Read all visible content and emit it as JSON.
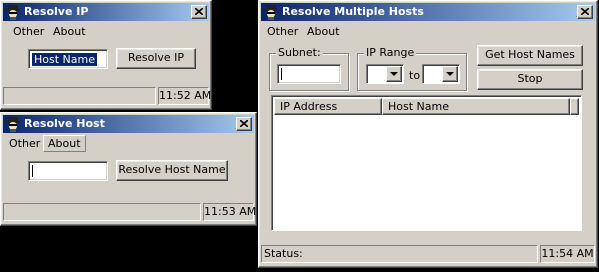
{
  "colors": {
    "desktop": "#000000",
    "window_face": "#d4d0c8",
    "title_active_start": "#0a246a",
    "title_active_end": "#a6caf0",
    "selection": "#0a246a"
  },
  "window_resolve_ip": {
    "title": "Resolve IP",
    "icon": "spy-icon",
    "menu": [
      {
        "label": "Other"
      },
      {
        "label": "About"
      }
    ],
    "hostname_input": {
      "value": "Host Name"
    },
    "resolve_button": "Resolve IP",
    "status": {
      "message": "",
      "clock": "11:52 AM"
    }
  },
  "window_resolve_host": {
    "title": "Resolve Host",
    "icon": "spy-icon",
    "menu": [
      {
        "label": "Other"
      },
      {
        "label": "About"
      }
    ],
    "ip_input": {
      "value": ""
    },
    "resolve_button": "Resolve Host Name",
    "status": {
      "message": "",
      "clock": "11:53 AM"
    }
  },
  "window_resolve_multiple": {
    "title": "Resolve Multiple Hosts",
    "icon": "spy-icon",
    "menu": [
      {
        "label": "Other"
      },
      {
        "label": "About"
      }
    ],
    "subnet_group": {
      "label": "Subnet:",
      "value": ""
    },
    "range_group": {
      "label": "IP Range",
      "from_value": "",
      "to_label": "to",
      "to_value": ""
    },
    "get_names_button": "Get Host Names",
    "stop_button": "Stop",
    "list": {
      "columns": [
        "IP Address",
        "Host Name"
      ],
      "rows": []
    },
    "status": {
      "message": "Status:",
      "clock": "11:54 AM"
    }
  }
}
